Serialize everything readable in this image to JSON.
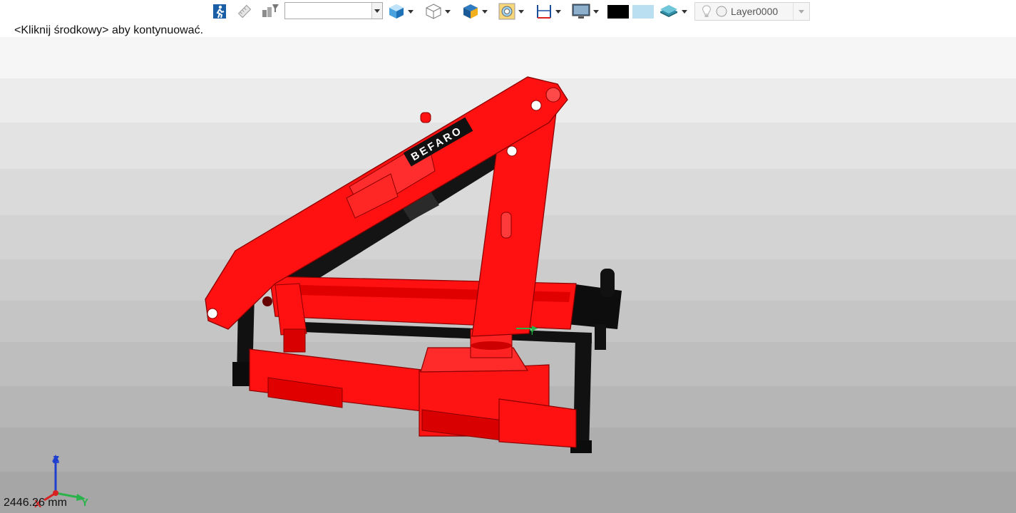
{
  "toolbar": {
    "combo_value": "",
    "layer_name": "Layer0000",
    "color_swatch_black": "#000000",
    "color_swatch_light": "#b9dff0"
  },
  "command_prompt": "<Kliknij środkowy> aby kontynuować.",
  "model": {
    "brand_label": "BEFARO",
    "colors": {
      "body": "#ff0f0f",
      "body_dark": "#b00000",
      "cylinder": "#111111"
    }
  },
  "axis_triad": {
    "x": "X",
    "y": "Y",
    "z": "Z"
  },
  "measurement": "2446.26 mm"
}
